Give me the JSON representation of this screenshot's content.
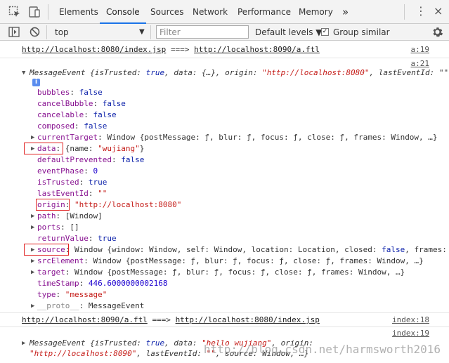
{
  "devtools": {
    "tabs": [
      {
        "label": "Elements"
      },
      {
        "label": "Console"
      },
      {
        "label": "Sources"
      },
      {
        "label": "Network"
      },
      {
        "label": "Performance"
      },
      {
        "label": "Memory"
      }
    ],
    "more_tabs": "»",
    "menu": "⋮",
    "close": "×"
  },
  "toolbar": {
    "context": "top",
    "filter_placeholder": "Filter",
    "levels": "Default levels ▼",
    "group_similar": "Group similar",
    "group_similar_checked": true
  },
  "console": {
    "line1": {
      "from": "http://localhost:8080/index.jsp",
      "arrow": "===>",
      "to": "http://localhost:8090/a.ftl",
      "source": "a:19"
    },
    "event1": {
      "source": "a:21",
      "summary_name": "MessageEvent",
      "summary_pre": " {isTrusted: ",
      "summary_true": "true",
      "summary_mid": ", data: {…}, origin: ",
      "summary_origin": "\"http://localhost:8080\"",
      "summary_tail": ", lastEventId: \"\", ",
      "props": [
        {
          "key": "bubbles",
          "value": "false"
        },
        {
          "key": "cancelBubble",
          "value": "false"
        },
        {
          "key": "cancelable",
          "value": "false"
        },
        {
          "key": "composed",
          "value": "false"
        },
        {
          "key": "currentTarget",
          "value": "Window {postMessage: ƒ, blur: ƒ, focus: ƒ, close: ƒ, frames: Window, …}"
        },
        {
          "key": "data",
          "value_pre": "{name: ",
          "value_str": "\"wujiang\"",
          "value_post": "}"
        },
        {
          "key": "defaultPrevented",
          "value": "false"
        },
        {
          "key": "eventPhase",
          "value": "0"
        },
        {
          "key": "isTrusted",
          "value": "true"
        },
        {
          "key": "lastEventId",
          "value": "\"\""
        },
        {
          "key": "origin",
          "value": "\"http://localhost:8080\""
        },
        {
          "key": "path",
          "value": "[Window]"
        },
        {
          "key": "ports",
          "value": "[]"
        },
        {
          "key": "returnValue",
          "value": "true"
        },
        {
          "key": "source",
          "value_pre": "Window {window: Window, self: Window, location: Location, closed: ",
          "value_bool": "false",
          "value_post": ", frames:"
        },
        {
          "key": "srcElement",
          "value": "Window {postMessage: ƒ, blur: ƒ, focus: ƒ, close: ƒ, frames: Window, …}"
        },
        {
          "key": "target",
          "value": "Window {postMessage: ƒ, blur: ƒ, focus: ƒ, close: ƒ, frames: Window, …}"
        },
        {
          "key": "timeStamp",
          "value": "446.6000000002168"
        },
        {
          "key": "type",
          "value": "\"message\""
        },
        {
          "key": "__proto__",
          "value": "MessageEvent"
        }
      ]
    },
    "line2": {
      "from": "http://localhost:8090/a.ftl",
      "arrow": "===>",
      "to": "http://localhost:8080/index.jsp",
      "source": "index:18"
    },
    "event2": {
      "source": "index:19",
      "l1_name": "MessageEvent",
      "l1_pre": " {isTrusted: ",
      "l1_true": "true",
      "l1_mid": ", data: ",
      "l1_data": "\"hello wujiang\"",
      "l1_post": ", origin:",
      "l2_origin": "\"http://localhost:8090\"",
      "l2_mid": ", lastEventId: ",
      "l2_empty": "\"\"",
      "l2_post": ", source: Window, …}"
    }
  },
  "watermark": "http://blog.csdn.net/harmsworth2016"
}
